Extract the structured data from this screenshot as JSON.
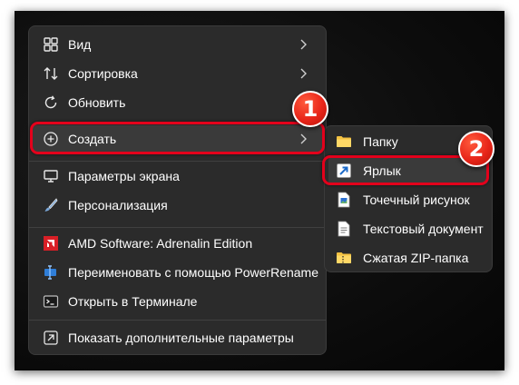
{
  "context_menu": {
    "items": [
      {
        "label": "Вид",
        "icon": "view-icon",
        "has_submenu": true
      },
      {
        "label": "Сортировка",
        "icon": "sort-icon",
        "has_submenu": true
      },
      {
        "label": "Обновить",
        "icon": "refresh-icon",
        "has_submenu": false
      },
      {
        "label": "Создать",
        "icon": "new-plus-icon",
        "has_submenu": true
      },
      {
        "label": "Параметры экрана",
        "icon": "display-settings-icon",
        "has_submenu": false
      },
      {
        "label": "Персонализация",
        "icon": "brush-icon",
        "has_submenu": false
      },
      {
        "label": "AMD Software: Adrenalin Edition",
        "icon": "amd-icon",
        "has_submenu": false
      },
      {
        "label": "Переименовать с помощью PowerRename",
        "icon": "powerrename-icon",
        "has_submenu": false
      },
      {
        "label": "Открыть в Терминале",
        "icon": "terminal-icon",
        "has_submenu": false
      },
      {
        "label": "Показать дополнительные параметры",
        "icon": "more-options-icon",
        "has_submenu": false
      }
    ]
  },
  "create_submenu": {
    "items": [
      {
        "label": "Папку",
        "icon": "folder-icon"
      },
      {
        "label": "Ярлык",
        "icon": "shortcut-icon"
      },
      {
        "label": "Точечный рисунок",
        "icon": "bitmap-icon"
      },
      {
        "label": "Текстовый документ",
        "icon": "text-document-icon"
      },
      {
        "label": "Сжатая ZIP-папка",
        "icon": "zip-folder-icon"
      }
    ]
  },
  "annotations": {
    "step1": "1",
    "step2": "2"
  },
  "colors": {
    "menu_bg": "#2b2b2b",
    "highlight": "#e3001b",
    "badge": "#e8261a",
    "text": "#ffffff"
  }
}
